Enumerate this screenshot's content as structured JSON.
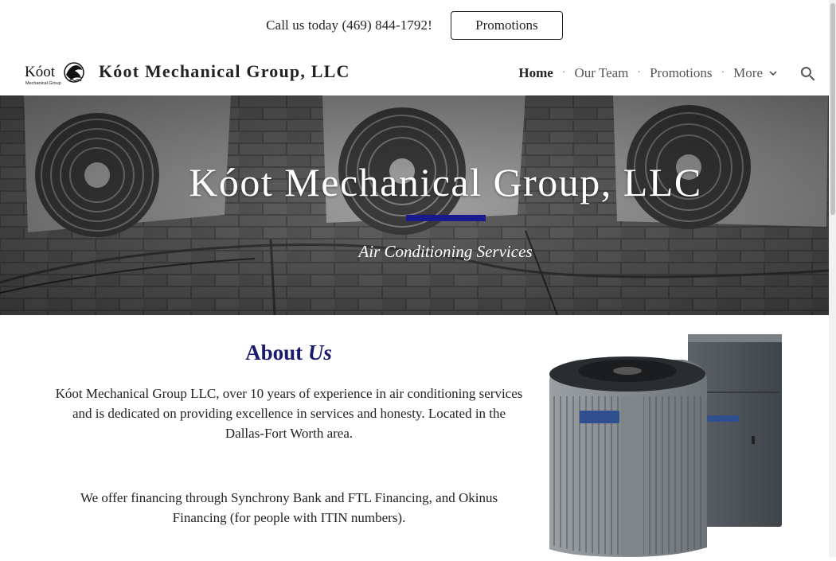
{
  "topbar": {
    "call_text": "Call us today (469) 844-1792!",
    "promo_button": "Promotions"
  },
  "header": {
    "logo_text": "Kóot",
    "logo_subtext": "Mechanical Group",
    "site_title": "Kóot Mechanical Group, LLC",
    "nav": {
      "home": "Home",
      "our_team": "Our Team",
      "promotions": "Promotions",
      "more": "More"
    }
  },
  "hero": {
    "title": "Kóot Mechanical Group, LLC",
    "subtitle": "Air Conditioning Services",
    "accent_color": "#1a1a8c"
  },
  "about": {
    "title_part1": "About",
    "title_part2": "Us",
    "paragraph1": "Kóot Mechanical Group LLC, over 10 years of experience in air conditioning services and is dedicated on providing excellence in services and honesty. Located in the Dallas-Fort Worth area.",
    "paragraph2": "We offer financing through Synchrony Bank and FTL Financing, and Okinus Financing (for people with ITIN numbers)."
  },
  "icons": {
    "search": "search-icon",
    "more": "chevron-down-icon"
  }
}
